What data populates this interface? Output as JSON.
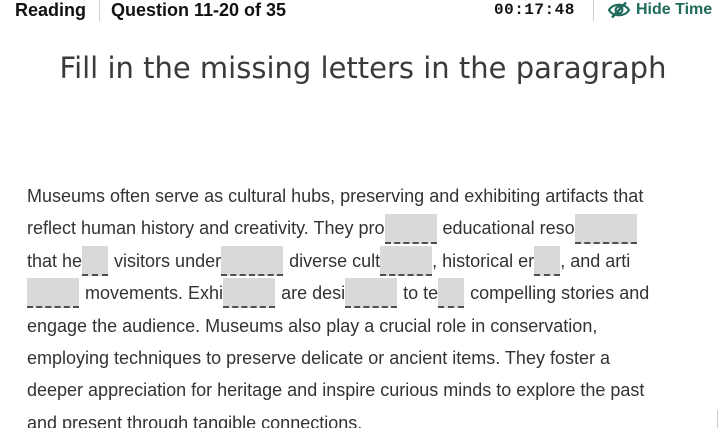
{
  "header": {
    "section": "Reading",
    "question_range": "Question 11-20 of 35",
    "timer": "00:17:48",
    "hide_time_label": "Hide Time",
    "hide_time_icon": "eye-slash-icon",
    "accent_color": "#1f6b5c"
  },
  "title": "Fill in the missing letters in the paragraph",
  "passage": {
    "line1": "Museums often serve as cultural hubs, preserving and exhibiting artifacts that",
    "line2_a": "reflect human history and creativity. They pro",
    "line2_b": "educational reso",
    "line3_a": "that he",
    "line3_b": "visitors under",
    "line3_c": "diverse cult",
    "line3_d": ", historical er",
    "line3_e": ", and arti",
    "line4_b": "movements. Exhi",
    "line4_c": "are desi",
    "line4_d": "to te",
    "line4_e": "compelling stories and",
    "line5": "engage the audience. Museums also play a crucial role in conservation,",
    "line6": "employing techniques to preserve delicate or ancient items. They foster a",
    "line7": "deeper appreciation for heritage and inspire curious minds to explore the past",
    "line8": "and present through tangible connections."
  },
  "blanks": [
    {
      "id": 1,
      "letters": 4,
      "value": ""
    },
    {
      "id": 2,
      "letters": 5,
      "value": ""
    },
    {
      "id": 3,
      "letters": 2,
      "value": ""
    },
    {
      "id": 4,
      "letters": 5,
      "value": ""
    },
    {
      "id": 5,
      "letters": 4,
      "value": ""
    },
    {
      "id": 6,
      "letters": 2,
      "value": ""
    },
    {
      "id": 7,
      "letters": 4,
      "value": ""
    },
    {
      "id": 8,
      "letters": 4,
      "value": ""
    },
    {
      "id": 9,
      "letters": 4,
      "value": ""
    },
    {
      "id": 10,
      "letters": 2,
      "value": ""
    }
  ]
}
